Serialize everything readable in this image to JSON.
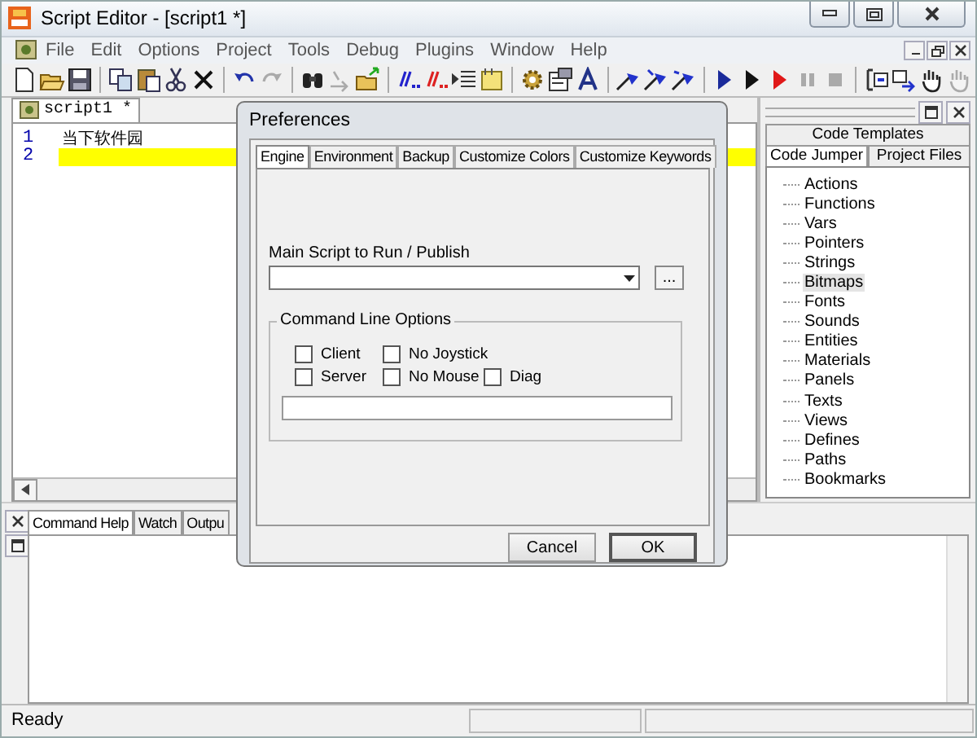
{
  "window": {
    "title": "Script Editor - [script1 *]"
  },
  "menu": [
    "File",
    "Edit",
    "Options",
    "Project",
    "Tools",
    "Debug",
    "Plugins",
    "Window",
    "Help"
  ],
  "editor": {
    "tabs": [
      {
        "label": "script1 *",
        "selected": true
      }
    ],
    "lines": [
      {
        "number": "1",
        "text": "当下软件园",
        "highlighted": false
      },
      {
        "number": "2",
        "highlighted": true
      }
    ]
  },
  "side_panel": {
    "tabs": [
      {
        "label": "Code Templates",
        "selected": false
      },
      {
        "label": "Code Jumper",
        "selected": true
      },
      {
        "label": "Project Files",
        "selected": false
      }
    ],
    "tree": [
      {
        "label": "Actions",
        "selected": false
      },
      {
        "label": "Functions",
        "selected": false
      },
      {
        "label": "Vars",
        "selected": false
      },
      {
        "label": "Pointers",
        "selected": false
      },
      {
        "label": "Strings",
        "selected": false
      },
      {
        "label": "Bitmaps",
        "selected": true
      },
      {
        "label": "Fonts",
        "selected": false
      },
      {
        "label": "Sounds",
        "selected": false
      },
      {
        "label": "Entities",
        "selected": false
      },
      {
        "label": "Materials",
        "selected": false
      },
      {
        "label": "Panels",
        "selected": false
      },
      {
        "label": "Texts",
        "selected": false
      },
      {
        "label": "Views",
        "selected": false
      },
      {
        "label": "Defines",
        "selected": false
      },
      {
        "label": "Paths",
        "selected": false
      },
      {
        "label": "Bookmarks",
        "selected": false
      }
    ]
  },
  "bottom_panel": {
    "tabs": [
      {
        "label": "Command Help",
        "selected": true
      },
      {
        "label": "Watch",
        "selected": false
      },
      {
        "label": "Outpu",
        "selected": false
      }
    ]
  },
  "status_bar": {
    "text": "Ready"
  },
  "dialog": {
    "title": "Preferences",
    "tabs": [
      {
        "label": "Engine",
        "selected": true
      },
      {
        "label": "Environment",
        "selected": false
      },
      {
        "label": "Backup",
        "selected": false
      },
      {
        "label": "Customize Colors",
        "selected": false
      },
      {
        "label": "Customize Keywords",
        "selected": false
      }
    ],
    "main_script": {
      "label": "Main Script to Run / Publish",
      "browse": "..."
    },
    "command_line": {
      "title": "Command Line Options",
      "options": [
        {
          "label": "Client",
          "checked": false
        },
        {
          "label": "No Joystick",
          "checked": false
        },
        {
          "label": "Server",
          "checked": false
        },
        {
          "label": "No Mouse",
          "checked": false
        },
        {
          "label": "Diag",
          "checked": false
        }
      ]
    },
    "buttons": [
      {
        "label": "Cancel",
        "default": false
      },
      {
        "label": "OK",
        "default": true
      }
    ]
  }
}
